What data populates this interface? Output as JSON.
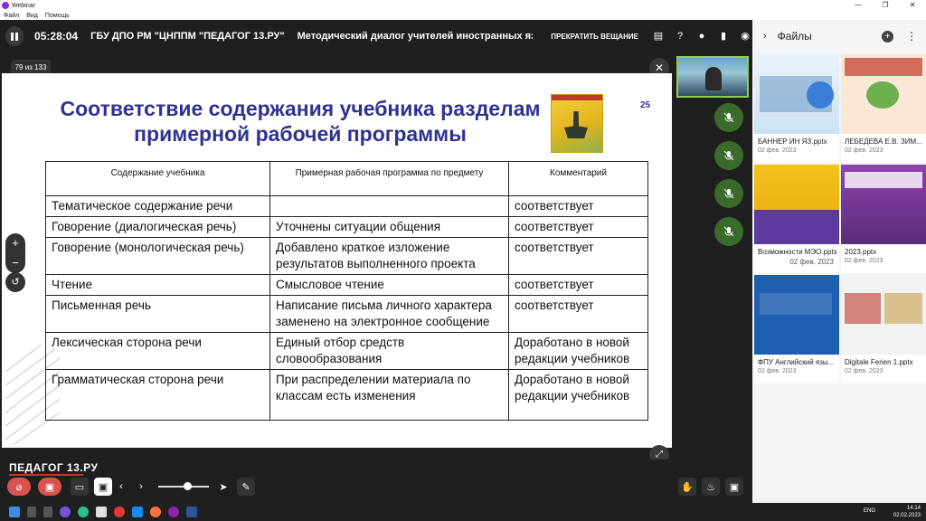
{
  "window": {
    "title": "Webinar",
    "minimize": "—",
    "maximize": "❐",
    "close": "✕"
  },
  "menu": [
    "Файл",
    "Вид",
    "Помощь"
  ],
  "topbar": {
    "timer": "05:28:04",
    "organization": "ГБУ ДПО РМ \"ЦНППМ \"ПЕДАГОГ 13.РУ\"",
    "event_title": "Методический диалог учителей иностранных языков П",
    "stop_label": "ПРЕКРАТИТЬ ВЕЩАНИЕ",
    "icons": [
      "chat-icon",
      "question-icon",
      "person-icon",
      "file-icon",
      "camera-icon"
    ]
  },
  "stage": {
    "page_counter": "79 из 133",
    "slide": {
      "title": "Соответствие содержания учебника разделам примерной рабочей программы",
      "number": "25",
      "columns": [
        "Содержание учебника",
        "Примерная рабочая программа  по предмету",
        "Комментарий"
      ],
      "rows": [
        [
          "Тематическое содержание речи",
          "",
          "соответствует"
        ],
        [
          "Говорение (диалогическая речь)",
          "Уточнены ситуации общения",
          "соответствует"
        ],
        [
          "Говорение (монологическая речь)",
          "Добавлено краткое изложение результатов выполненного  проекта",
          "соответствует"
        ],
        [
          "Чтение",
          "Смысловое чтение",
          "соответствует"
        ],
        [
          "Письменная речь",
          "Написание письма личного характера заменено на электронное сообщение",
          "соответствует"
        ],
        [
          "Лексическая сторона речи",
          "Единый отбор средств словообразования",
          "Доработано в новой редакции учебников"
        ],
        [
          "Грамматическая сторона речи",
          "При распределении материала по классам есть изменения",
          "Доработано в новой редакции учебников"
        ]
      ]
    }
  },
  "bottombar": {
    "brand": "ПЕДАГОГ 13.РУ"
  },
  "files_panel": {
    "title": "Файлы",
    "files": [
      {
        "name": "БАННЕР ИН ЯЗ.pptx",
        "date": "02 фев. 2023",
        "shared": false
      },
      {
        "name": "ЛЕБЕДЕВА Е.В. ЗИМ...",
        "date": "02 фев. 2023",
        "shared": false
      },
      {
        "name": "Возможности МЭО.pptx",
        "date": "02 фев. 2023",
        "shared": true
      },
      {
        "name": "2023.pptx",
        "date": "02 фев. 2023",
        "shared": false
      },
      {
        "name": "ФПУ Английский язы...",
        "date": "02 фев. 2023",
        "shared": false
      },
      {
        "name": "Digitale Ferien 1.pptx",
        "date": "02 фев. 2023",
        "shared": false
      }
    ]
  },
  "taskbar": {
    "lang": "ENG",
    "time": "14:14",
    "date": "02.02.2023"
  },
  "colors": {
    "accent_green": "#3a6b2a",
    "title_blue": "#2e3392",
    "mute_red": "#d9534f"
  }
}
